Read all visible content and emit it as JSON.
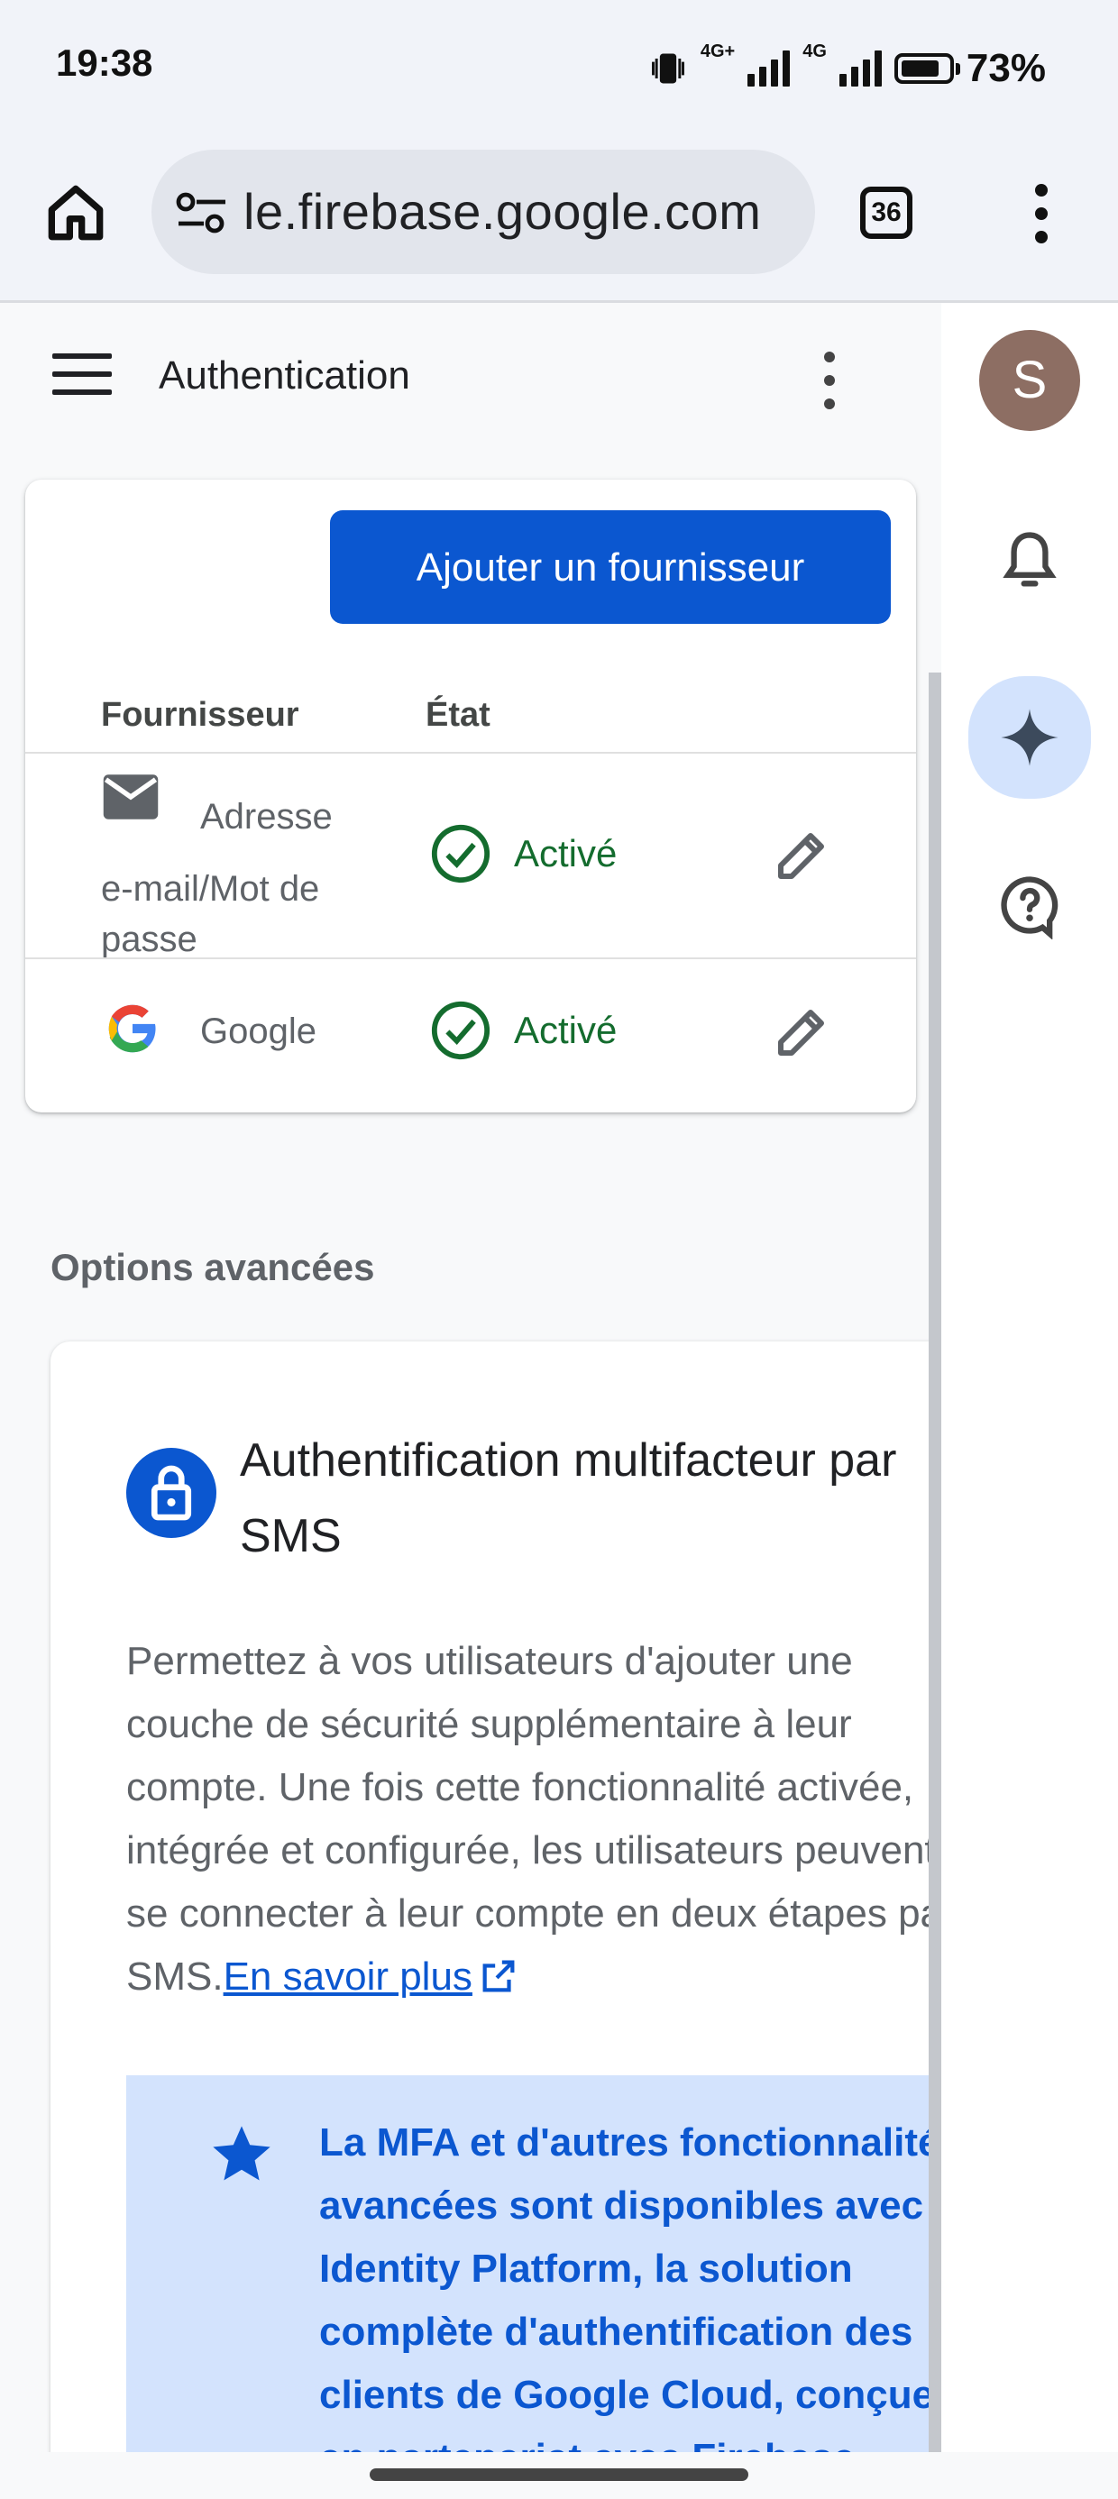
{
  "status_bar": {
    "time": "19:38",
    "network": "4G+",
    "network2": "4G",
    "battery": "73%",
    "battery_level": 0.73
  },
  "browser": {
    "url": "le.firebase.google.com",
    "tab_count": "36"
  },
  "header": {
    "title": "Authentication"
  },
  "rail": {
    "avatar_letter": "S"
  },
  "providers": {
    "add_button": "Ajouter un fournisseur",
    "columns": [
      "Fournisseur",
      "État"
    ],
    "rows": [
      {
        "name_line1": "Adresse",
        "name_line2": "e-mail/Mot de",
        "name_line3": "passe",
        "status": "Activé",
        "icon": "mail-icon"
      },
      {
        "name_line1": "Google",
        "status": "Activé",
        "icon": "google-logo-icon"
      }
    ]
  },
  "advanced": {
    "section_title": "Options avancées",
    "card_title": "Authentification multifacteur par SMS",
    "description": "Permettez à vos utilisateurs d'ajouter une\ncouche de sécurité supplémentaire à leur\ncompte. Une fois cette fonctionnalité activée,\nintégrée et configurée, les utilisateurs peuvent\nse connecter à leur compte en deux étapes par\nSMS.",
    "learn_more": "En savoir plus",
    "info_text": "La MFA et d'autres fonctionnalités\navancées sont disponibles avec\nIdentity Platform, la solution\ncomplète d'authentification des\nclients de Google Cloud, conçue\nen partenariat avec Firebase."
  },
  "colors": {
    "primary": "#0b57d0",
    "success": "#146c2e",
    "info_bg": "#d3e3fd",
    "avatar": "#8d6e63"
  }
}
